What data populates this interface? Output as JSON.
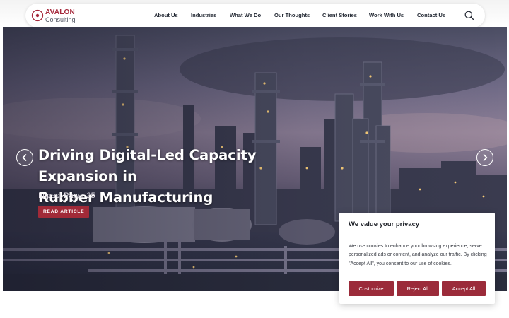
{
  "brand": {
    "name": "AVALON",
    "tagline": "Consulting",
    "color": "#a5273a"
  },
  "nav": {
    "items": [
      {
        "label": "About Us"
      },
      {
        "label": "Industries"
      },
      {
        "label": "What We Do"
      },
      {
        "label": "Our Thoughts"
      },
      {
        "label": "Client Stories"
      },
      {
        "label": "Work With Us"
      },
      {
        "label": "Contact Us"
      }
    ],
    "search_icon": "search-icon"
  },
  "hero": {
    "title": "Driving Digital-Led Capacity Expansion in\nRubber Manufacturing",
    "subtitle": "Impact Paper 25",
    "cta_label": "READ ARTICLE",
    "prev_icon": "chevron-left-icon",
    "next_icon": "chevron-right-icon"
  },
  "cookie_banner": {
    "title": "We value your privacy",
    "text": "We use cookies to enhance your browsing experience, serve personalized ads or content, and analyze our traffic. By clicking \"Accept All\", you consent to our use of cookies.",
    "buttons": [
      {
        "label": "Customize"
      },
      {
        "label": "Reject All"
      },
      {
        "label": "Accept All"
      }
    ],
    "button_color": "#9b2b3a"
  }
}
